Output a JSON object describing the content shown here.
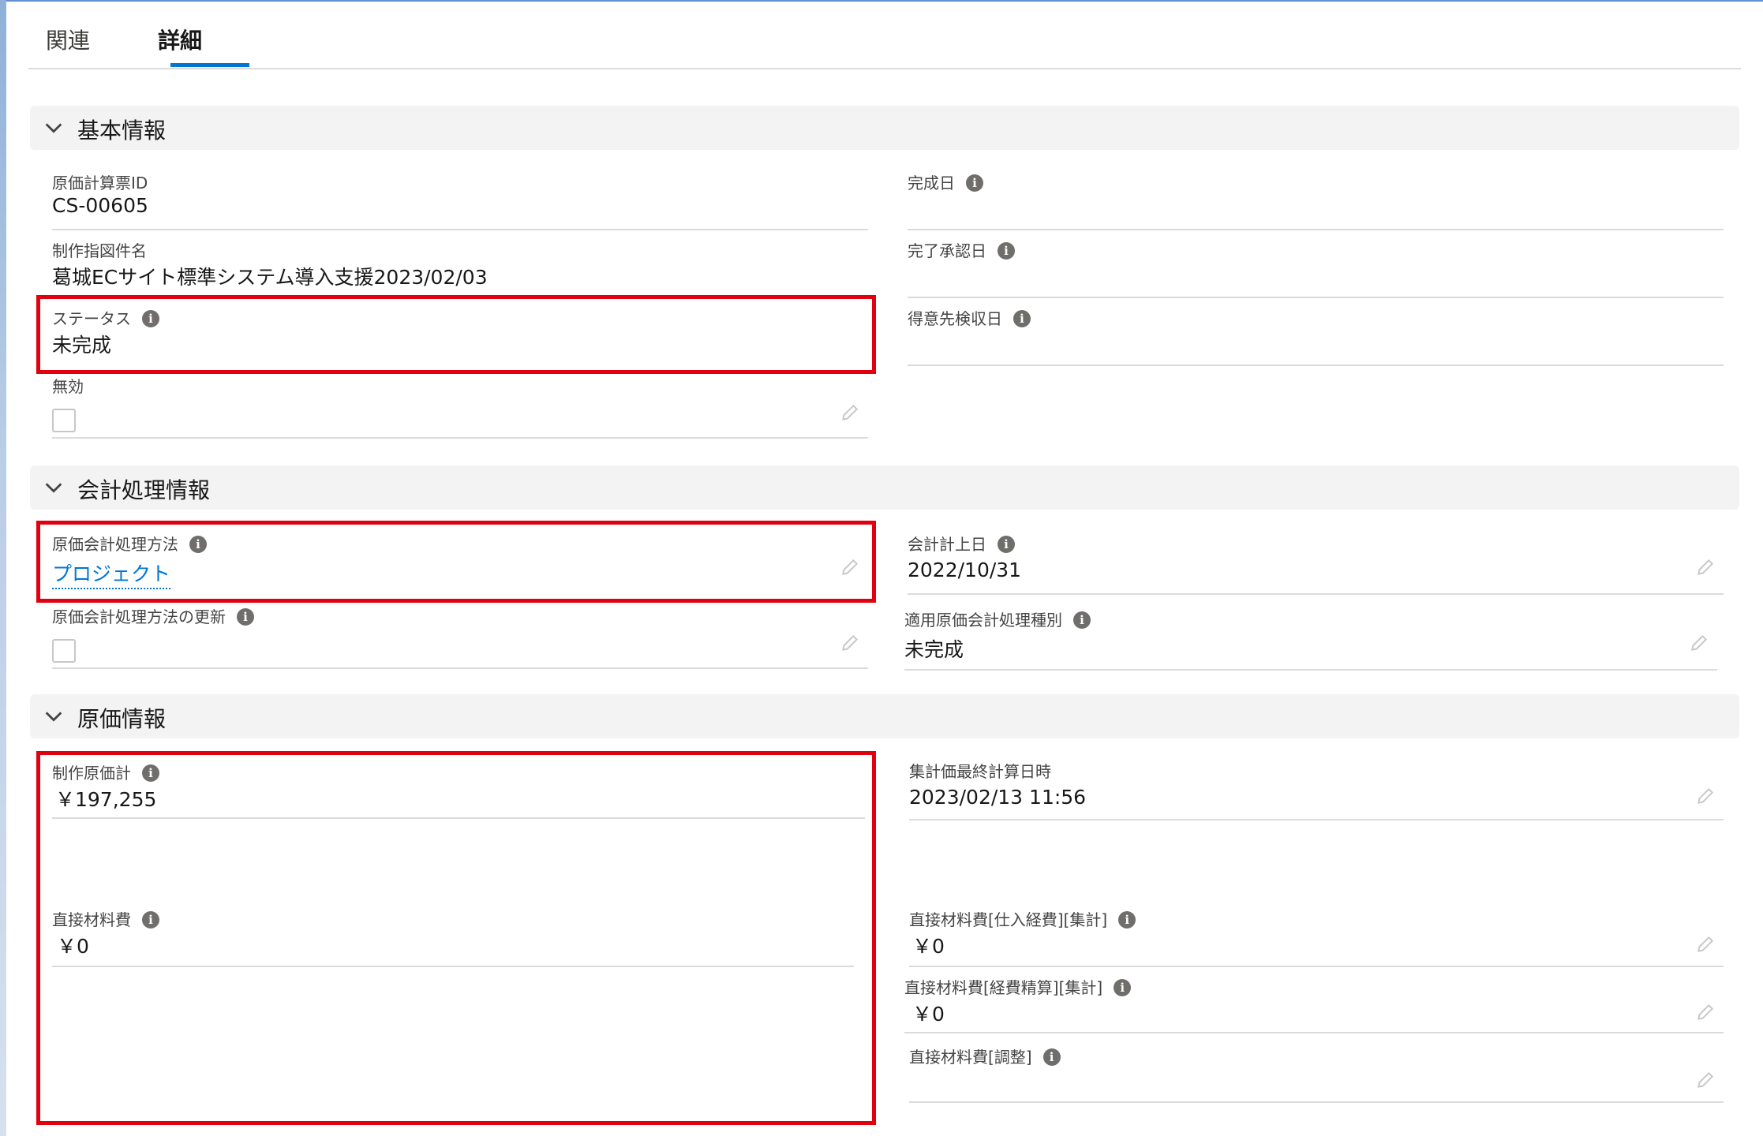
{
  "tabs": [
    {
      "label": "関連",
      "active": false
    },
    {
      "label": "詳細",
      "active": true
    }
  ],
  "sections": {
    "basic": {
      "title": "基本情報"
    },
    "accounting": {
      "title": "会計処理情報"
    },
    "cost": {
      "title": "原価情報"
    }
  },
  "fields": {
    "cost_sheet_id": {
      "label": "原価計算票ID",
      "value": "CS-00605"
    },
    "completion_date": {
      "label": "完成日",
      "value": ""
    },
    "work_order_name": {
      "label": "制作指図件名",
      "value": "葛城ECサイト標準システム導入支援2023/02/03"
    },
    "completion_approval_date": {
      "label": "完了承認日",
      "value": ""
    },
    "status": {
      "label": "ステータス",
      "value": "未完成"
    },
    "customer_acceptance_date": {
      "label": "得意先検収日",
      "value": ""
    },
    "inactive": {
      "label": "無効",
      "checked": false
    },
    "cost_accounting_method": {
      "label": "原価会計処理方法",
      "value": "プロジェクト"
    },
    "accounting_post_date": {
      "label": "会計計上日",
      "value": "2022/10/31"
    },
    "cost_accounting_method_update": {
      "label": "原価会計処理方法の更新",
      "checked": false
    },
    "applied_cost_accounting_type": {
      "label": "適用原価会計処理種別",
      "value": "未完成"
    },
    "production_cost_total": {
      "label": "制作原価計",
      "value": "￥197,255"
    },
    "aggregate_last_calc": {
      "label": "集計価最終計算日時",
      "value": "2023/02/13 11:56"
    },
    "direct_material_cost": {
      "label": "直接材料費",
      "value": "￥0"
    },
    "direct_material_purchase": {
      "label": "直接材料費[仕入経費][集計]",
      "value": "￥0"
    },
    "direct_material_expense": {
      "label": "直接材料費[経費精算][集計]",
      "value": "￥0"
    },
    "direct_material_adjust": {
      "label": "直接材料費[調整]",
      "value": ""
    }
  },
  "colors": {
    "highlight": "#e0000f",
    "link": "#0176d3",
    "tab_active_underline": "#0176d3"
  }
}
